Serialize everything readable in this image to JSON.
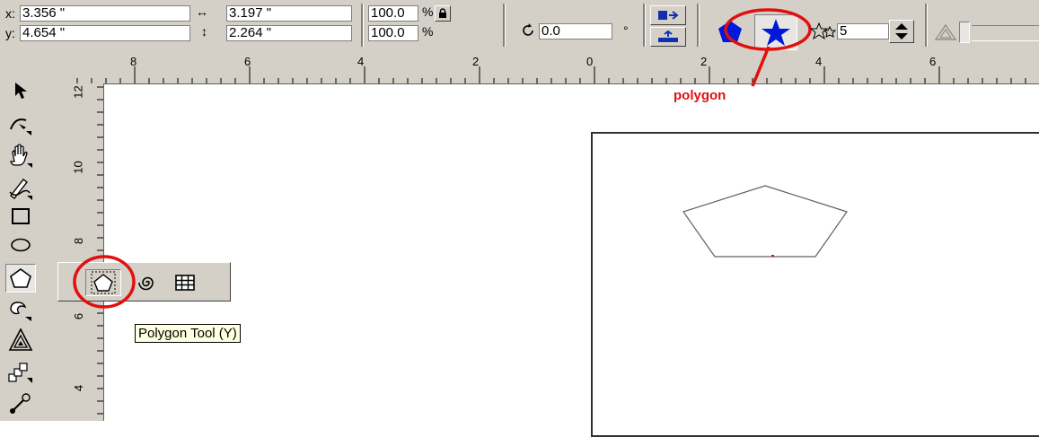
{
  "propbar": {
    "x_label": "x:",
    "x_value": "3.356 \"",
    "y_label": "y:",
    "y_value": "4.654 \"",
    "width_value": "3.197 \"",
    "height_value": "2.264 \"",
    "scale_x": "100.0",
    "scale_y": "100.0",
    "percent_sym": "%",
    "rotation_value": "0.0",
    "degree_sym": "°",
    "points_value": "5"
  },
  "ruler": {
    "h_ticks": [
      "8",
      "6",
      "4",
      "2",
      "0",
      "2",
      "4",
      "6"
    ],
    "v_ticks": [
      "12",
      "10",
      "8",
      "6",
      "4"
    ]
  },
  "annotation": {
    "text": "polygon",
    "color": "#e01010"
  },
  "tooltip": {
    "text": "Polygon Tool (Y)"
  },
  "icons": {
    "tools": [
      "pick-tool-icon",
      "shape-tool-icon",
      "zoom-hand-icon",
      "freehand-tool-icon",
      "rectangle-tool-icon",
      "ellipse-tool-icon",
      "polygon-tool-icon",
      "text-tool-icon",
      "interactive-fill-icon",
      "blend-tool-icon",
      "connector-tool-icon"
    ],
    "flyout": [
      "polygon-icon",
      "spiral-icon",
      "graph-paper-icon"
    ]
  }
}
